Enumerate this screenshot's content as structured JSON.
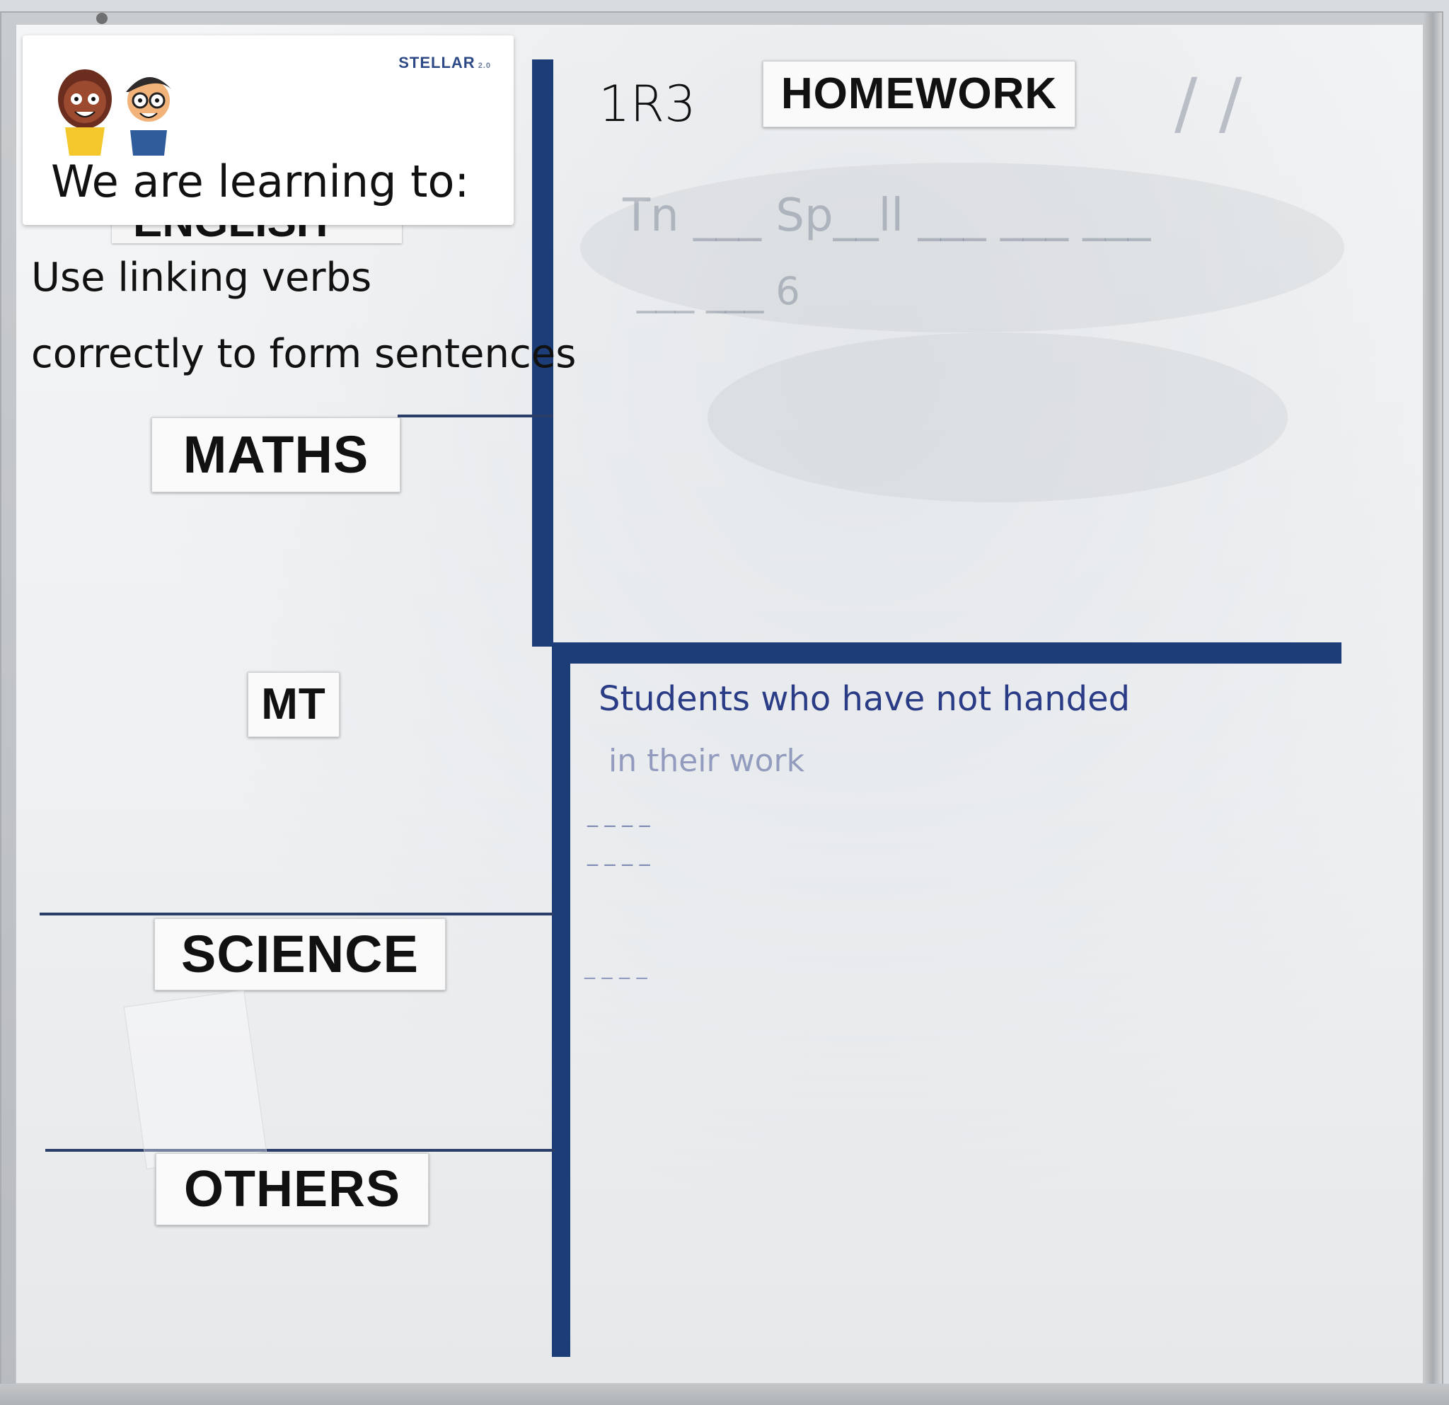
{
  "poster": {
    "brand": "STELLAR",
    "brand_version": "2.0",
    "tagline": "We are learning to:"
  },
  "class_name": "1R3",
  "labels": {
    "english": "ENGLISH",
    "homework": "HOMEWORK",
    "maths": "MATHS",
    "mt": "MT",
    "science": "SCIENCE",
    "others": "OTHERS"
  },
  "english_objective": {
    "line1": "Use linking verbs",
    "line2": "correctly to form sentences"
  },
  "homework_note": {
    "line1": "Students who have not handed",
    "line2": "in their work"
  },
  "colors": {
    "tape": "#1d3d78",
    "marker_blue": "#2a3c86",
    "board": "#f1f2f4"
  }
}
